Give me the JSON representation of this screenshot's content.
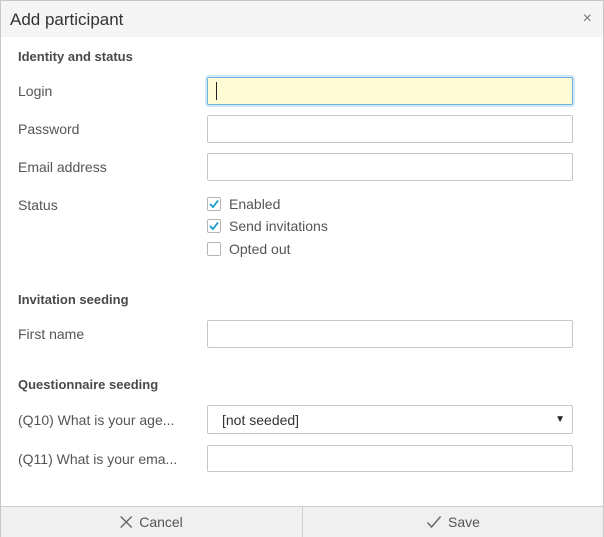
{
  "dialog": {
    "title": "Add participant",
    "close_glyph": "×"
  },
  "identity": {
    "heading": "Identity and status",
    "login_label": "Login",
    "login_value": "",
    "password_label": "Password",
    "password_value": "",
    "email_label": "Email address",
    "email_value": "",
    "status_label": "Status",
    "checkboxes": [
      {
        "label": "Enabled",
        "checked": true
      },
      {
        "label": "Send invitations",
        "checked": true
      },
      {
        "label": "Opted out",
        "checked": false
      }
    ]
  },
  "invitation": {
    "heading": "Invitation seeding",
    "first_name_label": "First name",
    "first_name_value": ""
  },
  "questionnaire": {
    "heading": "Questionnaire seeding",
    "q10_label": "(Q10) What is your age...",
    "q10_selected": "[not seeded]",
    "q11_label": "(Q11) What is your ema...",
    "q11_value": ""
  },
  "footer": {
    "cancel_label": "Cancel",
    "save_label": "Save"
  },
  "colors": {
    "accent": "#1a9bc9",
    "focus_bg": "#fffbd4"
  },
  "icons": {
    "close": "close-icon",
    "cancel": "x-icon",
    "save": "check-icon",
    "dropdown": "caret-down-icon"
  }
}
